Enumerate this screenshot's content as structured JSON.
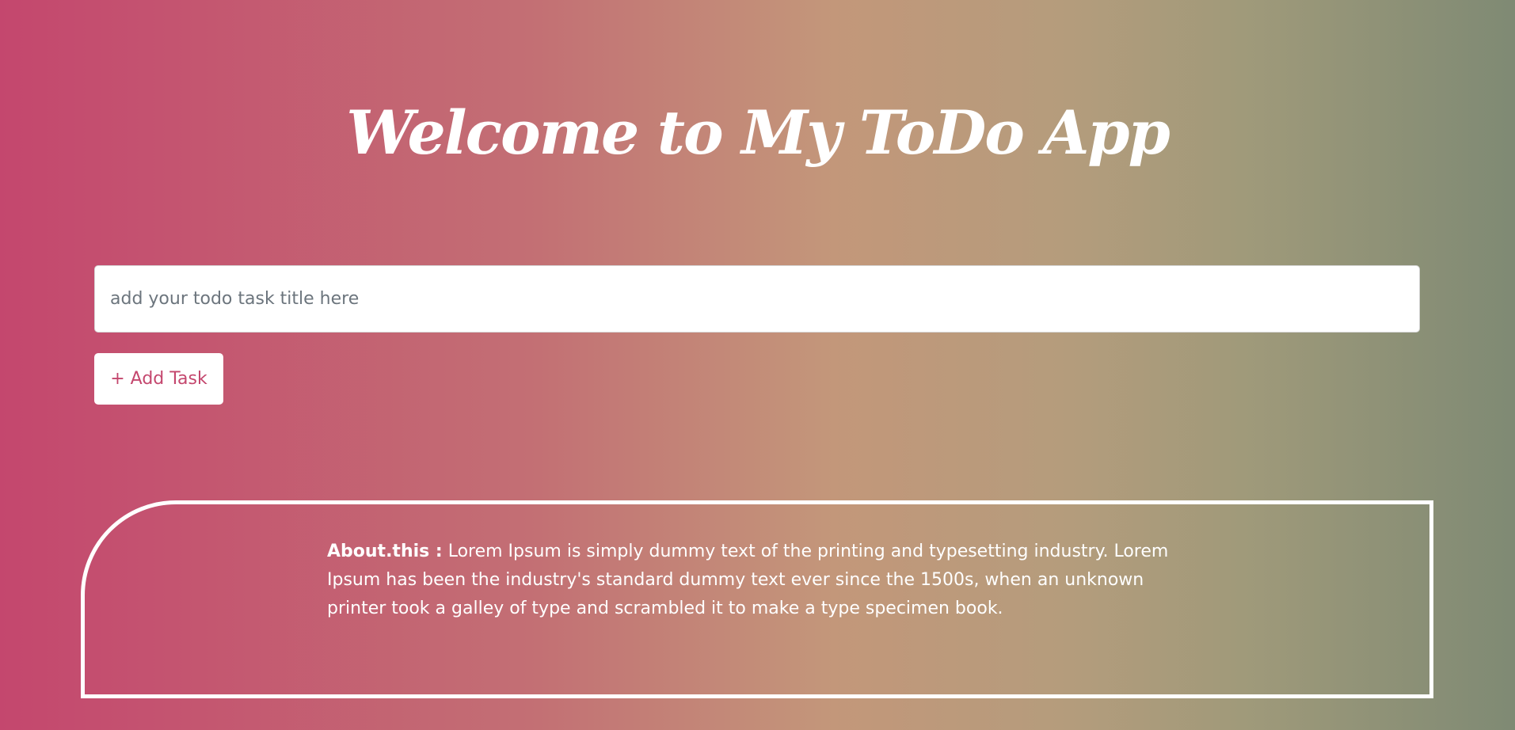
{
  "header": {
    "title": "Welcome to My ToDo App"
  },
  "form": {
    "input_placeholder": "add your todo task title here",
    "input_value": "",
    "add_button_label": "+ Add Task"
  },
  "about": {
    "label": "About.this :",
    "text": "Lorem Ipsum is simply dummy text of the printing and typesetting industry. Lorem Ipsum has been the industry's standard dummy text ever since the 1500s, when an unknown printer took a galley of type and scrambled it to make a type specimen book."
  },
  "colors": {
    "gradient_start": "#c4476e",
    "gradient_mid": "#c3977a",
    "gradient_end": "#7f8a74",
    "button_text": "#c4476e",
    "text_light": "#ffffff"
  }
}
